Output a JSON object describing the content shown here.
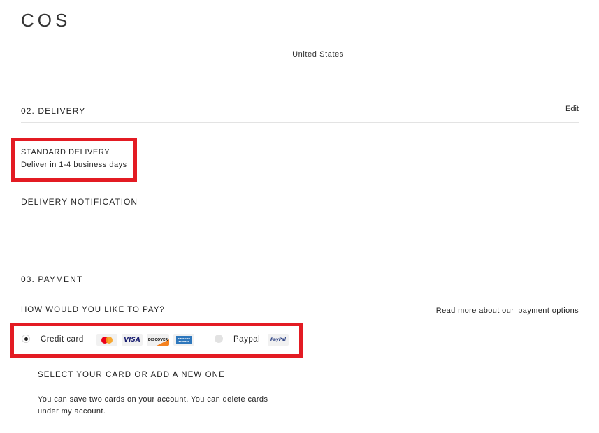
{
  "header": {
    "logo": "COS"
  },
  "address": {
    "country": "United States"
  },
  "delivery": {
    "section_title": "02.  DELIVERY",
    "edit_label": "Edit",
    "method_name": "STANDARD DELIVERY",
    "method_desc": "Deliver in 1-4 business days",
    "notification_title": "DELIVERY NOTIFICATION"
  },
  "payment": {
    "section_title": "03.  PAYMENT",
    "question": "HOW WOULD YOU LIKE TO PAY?",
    "read_more_prefix": "Read more about our",
    "read_more_link": "payment options",
    "options": [
      {
        "label": "Credit card",
        "selected": true
      },
      {
        "label": "Paypal",
        "selected": false
      }
    ],
    "card_logos": {
      "mastercard": "mastercard-icon",
      "visa": "VISA",
      "discover": "DISCOVER",
      "amex": "AMERICAN EXPRESS",
      "paypal": "PayPal"
    },
    "select_card_title": "SELECT YOUR CARD OR ADD A NEW ONE",
    "save_cards_text": "You can save two cards on your account. You can delete cards under my account."
  },
  "colors": {
    "highlight": "#e31b23",
    "visa_blue": "#1a1f71",
    "discover_orange": "#f58220",
    "amex_blue": "#2e77bc",
    "paypal_blue": "#253b80"
  }
}
